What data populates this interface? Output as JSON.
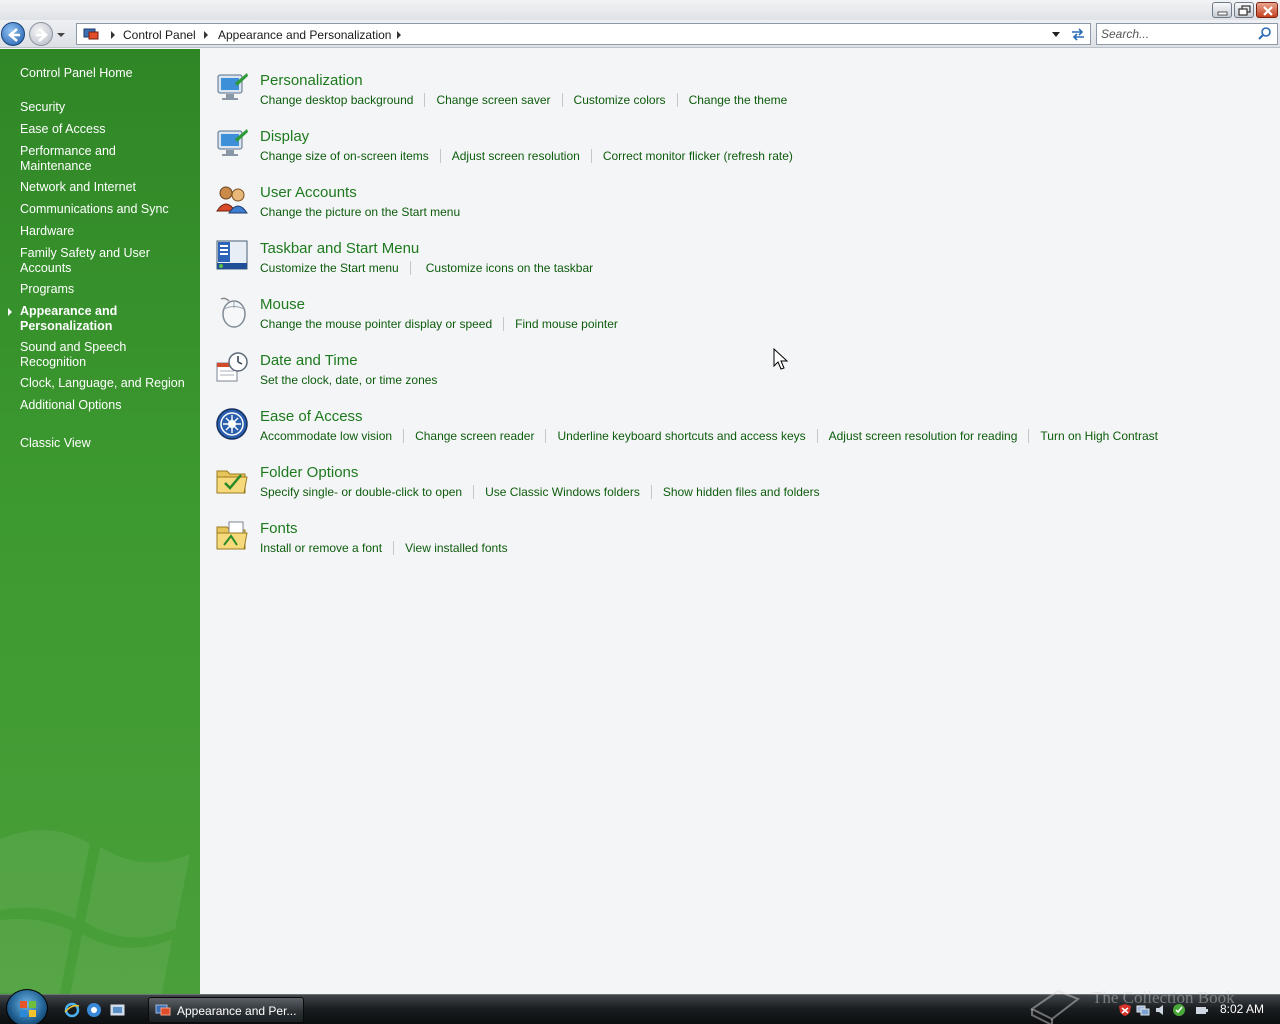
{
  "address_bar": {
    "crumbs": [
      "Control Panel",
      "Appearance and Personalization"
    ],
    "search_placeholder": "Search..."
  },
  "sidebar": {
    "items": [
      {
        "label": "Control Panel Home"
      },
      {
        "label": "Security"
      },
      {
        "label": "Ease of Access"
      },
      {
        "label": "Performance and Maintenance"
      },
      {
        "label": "Network and Internet"
      },
      {
        "label": "Communications and Sync"
      },
      {
        "label": "Hardware"
      },
      {
        "label": "Family Safety and User Accounts"
      },
      {
        "label": "Programs"
      },
      {
        "label": "Appearance and Personalization",
        "active": true
      },
      {
        "label": "Sound and Speech Recognition"
      },
      {
        "label": "Clock, Language, and Region"
      },
      {
        "label": "Additional Options"
      },
      {
        "label": "Classic View"
      }
    ]
  },
  "categories": [
    {
      "title": "Personalization",
      "icon": "personalization-icon",
      "tasks": [
        "Change desktop background",
        "Change screen saver",
        "Customize colors",
        "Change the theme"
      ]
    },
    {
      "title": "Display",
      "icon": "display-icon",
      "tasks": [
        "Change size of on-screen items",
        "Adjust screen resolution",
        "Correct monitor flicker (refresh rate)"
      ]
    },
    {
      "title": "User Accounts",
      "icon": "user-accounts-icon",
      "tasks": [
        "Change the picture on the Start menu"
      ]
    },
    {
      "title": "Taskbar and Start Menu",
      "icon": "taskbar-icon",
      "tasks": [
        "Customize the Start menu",
        "Customize icons on the taskbar"
      ]
    },
    {
      "title": "Mouse",
      "icon": "mouse-icon",
      "tasks": [
        "Change the mouse pointer display or speed",
        "Find mouse pointer"
      ]
    },
    {
      "title": "Date and Time",
      "icon": "clock-icon",
      "tasks": [
        "Set the clock, date, or time zones"
      ]
    },
    {
      "title": "Ease of Access",
      "icon": "ease-of-access-icon",
      "tasks": [
        "Accommodate low vision",
        "Change screen reader",
        "Underline keyboard shortcuts and access keys",
        "Adjust screen resolution for reading",
        "Turn on High Contrast"
      ]
    },
    {
      "title": "Folder Options",
      "icon": "folder-options-icon",
      "tasks": [
        "Specify single- or double-click to open",
        "Use Classic Windows folders",
        "Show hidden files and folders"
      ]
    },
    {
      "title": "Fonts",
      "icon": "fonts-folder-icon",
      "tasks": [
        "Install or remove a font",
        "View installed fonts"
      ]
    }
  ],
  "taskbar": {
    "window_button_label": "Appearance and Per...",
    "clock": "8:02 AM",
    "watermark": "The Collection Book"
  },
  "colors": {
    "sidebar_green": "#3d9a30",
    "link_green": "#1e7a1e",
    "content_bg": "#f4f5f6"
  }
}
